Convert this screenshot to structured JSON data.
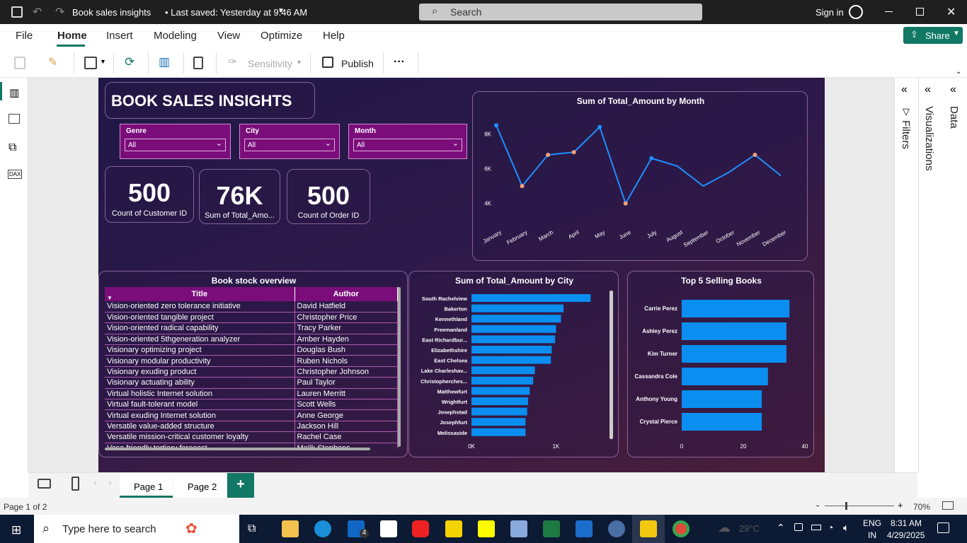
{
  "window": {
    "title": "Book sales insights",
    "saved": "• Last saved: Yesterday at 9:46 AM",
    "search": "Search",
    "signin": "Sign in",
    "share": "Share"
  },
  "menu": [
    "File",
    "Home",
    "Insert",
    "Modeling",
    "View",
    "Optimize",
    "Help"
  ],
  "toolbar": {
    "sensitivity": "Sensitivity",
    "publish": "Publish",
    "more": "···"
  },
  "report": {
    "title": "BOOK SALES INSIGHTS",
    "slicers": [
      {
        "label": "Genre",
        "value": "All"
      },
      {
        "label": "City",
        "value": "All"
      },
      {
        "label": "Month",
        "value": "All"
      }
    ],
    "kpis": [
      {
        "value": "500",
        "label": "Count of Customer ID"
      },
      {
        "value": "76K",
        "label": "Sum of Total_Amo..."
      },
      {
        "value": "500",
        "label": "Count of Order ID"
      }
    ],
    "table_title": "Book stock overview",
    "table": {
      "headers": [
        "Title",
        "Author"
      ],
      "rows": [
        [
          "Vision-oriented zero tolerance initiative",
          "David Hatfield"
        ],
        [
          "Vision-oriented tangible project",
          "Christopher Price"
        ],
        [
          "Vision-oriented radical capability",
          "Tracy Parker"
        ],
        [
          "Vision-oriented 5thgeneration analyzer",
          "Amber Hayden"
        ],
        [
          "Visionary optimizing project",
          "Douglas Bush"
        ],
        [
          "Visionary modular productivity",
          "Ruben Nichols"
        ],
        [
          "Visionary exuding product",
          "Christopher Johnson"
        ],
        [
          "Visionary actuating ability",
          "Paul Taylor"
        ],
        [
          "Virtual holistic Internet solution",
          "Lauren Merritt"
        ],
        [
          "Virtual fault-tolerant model",
          "Scott Wells"
        ],
        [
          "Virtual exuding Internet solution",
          "Anne George"
        ],
        [
          "Versatile value-added structure",
          "Jackson Hill"
        ],
        [
          "Versatile mission-critical customer loyalty",
          "Rachel Case"
        ],
        [
          "Vasa friendly tertiary forecast",
          "Malik Stephens"
        ]
      ]
    }
  },
  "chart_data": [
    {
      "type": "line",
      "title": "Sum of Total_Amount by Month",
      "categories": [
        "January",
        "February",
        "March",
        "April",
        "May",
        "June",
        "July",
        "August",
        "September",
        "October",
        "November",
        "December"
      ],
      "values": [
        8500,
        5000,
        6800,
        6950,
        8400,
        4000,
        6600,
        6150,
        5000,
        5800,
        6800,
        5600
      ],
      "yticks": [
        "8K",
        "6K",
        "4K"
      ],
      "ylim": [
        3500,
        9200
      ]
    },
    {
      "type": "bar",
      "orientation": "horizontal",
      "title": "Sum of Total_Amount by City",
      "categories": [
        "South Rachelview",
        "Bakerton",
        "Kennethland",
        "Freemanland",
        "East Richardbur...",
        "Elizabethshire",
        "East Chelsea",
        "Lake Charleshav...",
        "Christopherches...",
        "Matthewfurt",
        "Wrightfurt",
        "Josephstad",
        "Josephfurt",
        "Melissaside"
      ],
      "values": [
        1410,
        1090,
        1060,
        1000,
        990,
        950,
        940,
        750,
        730,
        690,
        670,
        660,
        640,
        640
      ],
      "xticks": [
        "0K",
        "1K"
      ],
      "xlim": [
        0,
        1550
      ]
    },
    {
      "type": "bar",
      "orientation": "horizontal",
      "title": "Top 5 Selling Books",
      "categories": [
        "Carrie Perez",
        "Ashley Perez",
        "Kim Turner",
        "Cassandra Cole",
        "Anthony Young",
        "Crystal Pierce"
      ],
      "values": [
        35,
        34,
        34,
        28,
        26,
        26
      ],
      "xticks": [
        "0",
        "20",
        "40"
      ],
      "xlim": [
        0,
        40
      ]
    }
  ],
  "pages": {
    "tabs": [
      "Page 1",
      "Page 2"
    ],
    "add": "+",
    "status": "Page 1 of 2",
    "zoom": "70%"
  },
  "taskbar": {
    "search": "Type here to search",
    "weather": "29°C",
    "lang1": "ENG",
    "lang2": "IN",
    "time": "8:31 AM",
    "date": "4/29/2025",
    "mail_badge": "4"
  },
  "panes": {
    "filters": "Filters",
    "visualizations": "Visualizations",
    "data": "Data"
  },
  "colors": {
    "accent": "#117865",
    "bar": "#0a8ef0",
    "line": "#1e8fff",
    "marker": "#f4a07a",
    "slicer": "#7b0d7b"
  }
}
